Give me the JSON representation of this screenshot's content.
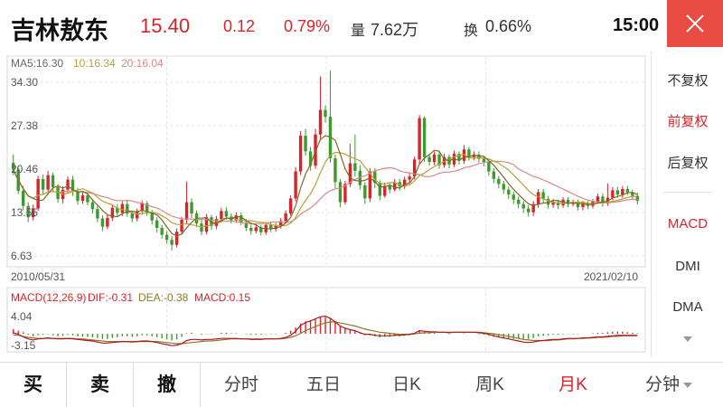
{
  "header": {
    "stock_name": "吉林敖东",
    "price": "15.40",
    "change": "0.12",
    "change_pct": "0.79%",
    "volume_label": "量",
    "volume_value": "7.62万",
    "turnover_label": "换",
    "turnover_value": "0.66%",
    "time": "15:00",
    "close_icon": "close-icon"
  },
  "ma_legend": {
    "ma5": "MA5:16.30",
    "ma10": "10:16.34",
    "ma20": "20:16.04"
  },
  "price_axis": [
    "34.30",
    "27.38",
    "20.46",
    "13.55",
    "6.63"
  ],
  "dates": {
    "start": "2010/05/31",
    "end": "2021/02/10"
  },
  "macd_legend": {
    "params": "MACD(12,26,9)",
    "dif": "DIF:-0.31",
    "dea": "DEA:-0.38",
    "macd": "MACD:0.15"
  },
  "macd_axis": {
    "top": "4.04",
    "bottom": "-3.15"
  },
  "side_panel": {
    "items": [
      "不复权",
      "前复权",
      "后复权"
    ],
    "active": "前复权",
    "indicators": [
      "MACD",
      "DMI",
      "DMA"
    ],
    "active_indicator": "MACD"
  },
  "tabs": {
    "buy": "买",
    "sell": "卖",
    "cancel": "撤",
    "intraday": "分时",
    "five_day": "五日",
    "daily": "日K",
    "weekly": "周K",
    "monthly": "月K",
    "minute": "分钟",
    "active": "月K"
  },
  "colors": {
    "up": "#d9232b",
    "down": "#3e9a2c",
    "ma5": "#7a6a2a",
    "ma10": "#b7a234",
    "ma20": "#d98a8a",
    "accent": "#d9232b"
  },
  "chart_data": {
    "type": "candlestick",
    "ylim": [
      6.63,
      34.3
    ],
    "candles": [
      [
        21.5,
        20.4,
        22.8,
        19.5
      ],
      [
        20.4,
        17.0,
        20.8,
        16.5
      ],
      [
        17.0,
        14.6,
        17.8,
        13.9
      ],
      [
        14.6,
        12.8,
        15.2,
        12.0
      ],
      [
        12.8,
        14.2,
        14.8,
        12.3
      ],
      [
        14.2,
        18.9,
        19.4,
        13.8
      ],
      [
        18.9,
        17.2,
        19.6,
        16.4
      ],
      [
        17.2,
        19.5,
        20.2,
        16.8
      ],
      [
        19.5,
        17.6,
        19.9,
        16.9
      ],
      [
        17.6,
        15.7,
        18.1,
        15.1
      ],
      [
        15.7,
        17.2,
        17.7,
        15.0
      ],
      [
        17.2,
        18.8,
        19.3,
        16.6
      ],
      [
        18.8,
        16.9,
        19.4,
        16.2
      ],
      [
        16.9,
        15.4,
        17.5,
        14.8
      ],
      [
        15.4,
        16.3,
        16.9,
        14.9
      ],
      [
        16.3,
        15.2,
        16.8,
        14.7
      ],
      [
        15.2,
        14.1,
        15.7,
        13.4
      ],
      [
        14.1,
        12.6,
        14.6,
        12.0
      ],
      [
        12.6,
        11.3,
        13.1,
        10.6
      ],
      [
        11.3,
        12.7,
        13.2,
        10.9
      ],
      [
        12.7,
        14.3,
        14.8,
        12.2
      ],
      [
        14.3,
        13.5,
        14.9,
        12.8
      ],
      [
        13.5,
        14.9,
        15.4,
        13.0
      ],
      [
        14.9,
        13.4,
        15.6,
        12.9
      ],
      [
        13.4,
        12.6,
        13.9,
        12.0
      ],
      [
        12.6,
        13.8,
        14.2,
        12.1
      ],
      [
        13.8,
        15.0,
        15.5,
        13.2
      ],
      [
        15.0,
        13.6,
        15.4,
        13.0
      ],
      [
        13.6,
        12.3,
        14.0,
        11.6
      ],
      [
        12.3,
        11.1,
        12.8,
        10.4
      ],
      [
        11.1,
        10.0,
        11.6,
        9.4
      ],
      [
        10.0,
        9.2,
        10.6,
        8.6
      ],
      [
        9.2,
        8.4,
        9.8,
        7.5
      ],
      [
        8.4,
        10.5,
        11.0,
        8.0
      ],
      [
        10.5,
        12.4,
        12.9,
        10.0
      ],
      [
        12.4,
        15.2,
        18.5,
        11.8
      ],
      [
        15.2,
        13.4,
        15.8,
        12.7
      ],
      [
        13.4,
        11.8,
        13.9,
        11.2
      ],
      [
        11.8,
        10.5,
        12.4,
        9.9
      ],
      [
        10.5,
        12.8,
        13.3,
        10.1
      ],
      [
        12.8,
        11.4,
        13.2,
        10.8
      ],
      [
        11.4,
        12.5,
        13.0,
        10.9
      ],
      [
        12.5,
        13.8,
        14.3,
        12.0
      ],
      [
        13.8,
        12.9,
        14.4,
        12.4
      ],
      [
        12.9,
        12.3,
        13.4,
        11.8
      ],
      [
        12.3,
        13.1,
        13.6,
        11.9
      ],
      [
        13.1,
        12.0,
        13.5,
        11.5
      ],
      [
        12.0,
        11.1,
        12.5,
        10.6
      ],
      [
        11.1,
        10.6,
        11.6,
        10.0
      ],
      [
        10.6,
        11.2,
        11.7,
        10.2
      ],
      [
        11.2,
        10.4,
        11.6,
        9.9
      ],
      [
        10.4,
        11.6,
        12.0,
        10.0
      ],
      [
        11.6,
        10.9,
        12.0,
        10.4
      ],
      [
        10.9,
        11.4,
        11.9,
        10.5
      ],
      [
        11.4,
        12.2,
        12.7,
        11.0
      ],
      [
        12.2,
        13.4,
        13.9,
        11.8
      ],
      [
        13.4,
        15.8,
        16.3,
        13.0
      ],
      [
        15.8,
        20.1,
        20.8,
        15.3
      ],
      [
        20.1,
        25.8,
        26.5,
        19.5
      ],
      [
        25.8,
        23.3,
        26.9,
        22.6
      ],
      [
        23.3,
        21.0,
        24.0,
        20.2
      ],
      [
        21.0,
        26.0,
        26.9,
        20.5
      ],
      [
        26.0,
        29.9,
        35.2,
        25.2
      ],
      [
        29.9,
        28.8,
        30.6,
        27.9
      ],
      [
        28.8,
        22.2,
        36.2,
        21.5
      ],
      [
        22.2,
        18.4,
        22.8,
        17.4
      ],
      [
        18.4,
        15.2,
        18.9,
        14.4
      ],
      [
        15.2,
        18.1,
        18.6,
        14.8
      ],
      [
        18.1,
        21.4,
        24.5,
        17.6
      ],
      [
        21.4,
        20.2,
        26.0,
        19.3
      ],
      [
        20.2,
        17.9,
        21.1,
        17.2
      ],
      [
        17.9,
        15.8,
        18.4,
        14.9
      ],
      [
        15.8,
        20.1,
        20.6,
        15.2
      ],
      [
        20.1,
        18.3,
        20.6,
        17.4
      ],
      [
        18.3,
        16.2,
        18.7,
        15.5
      ],
      [
        16.2,
        17.8,
        18.3,
        15.9
      ],
      [
        17.8,
        17.2,
        18.2,
        16.6
      ],
      [
        17.2,
        18.4,
        18.9,
        16.9
      ],
      [
        18.4,
        17.7,
        18.9,
        17.1
      ],
      [
        17.7,
        18.8,
        19.3,
        17.3
      ],
      [
        18.8,
        19.3,
        19.8,
        18.2
      ],
      [
        19.3,
        22.0,
        22.5,
        18.8
      ],
      [
        22.0,
        28.6,
        29.1,
        21.4
      ],
      [
        28.6,
        22.4,
        28.9,
        21.6
      ],
      [
        22.4,
        21.6,
        22.9,
        21.0
      ],
      [
        21.6,
        22.8,
        23.3,
        21.1
      ],
      [
        22.8,
        21.1,
        23.2,
        20.5
      ],
      [
        21.1,
        22.4,
        22.9,
        20.7
      ],
      [
        22.4,
        21.2,
        22.8,
        20.6
      ],
      [
        21.2,
        22.9,
        23.4,
        20.8
      ],
      [
        22.9,
        21.8,
        23.3,
        21.2
      ],
      [
        21.8,
        23.6,
        24.3,
        21.3
      ],
      [
        23.6,
        22.4,
        24.0,
        21.8
      ],
      [
        22.4,
        22.8,
        23.3,
        21.9
      ],
      [
        22.8,
        22.1,
        23.3,
        21.5
      ],
      [
        22.1,
        21.6,
        22.5,
        20.9
      ],
      [
        21.6,
        20.1,
        22.0,
        19.4
      ],
      [
        20.1,
        18.9,
        20.6,
        18.2
      ],
      [
        18.9,
        18.1,
        19.4,
        17.4
      ],
      [
        18.1,
        17.2,
        18.6,
        16.5
      ],
      [
        17.2,
        16.4,
        17.7,
        15.7
      ],
      [
        16.4,
        15.6,
        16.9,
        14.9
      ],
      [
        15.6,
        14.9,
        16.1,
        14.2
      ],
      [
        14.9,
        14.2,
        15.4,
        13.5
      ],
      [
        14.2,
        13.6,
        14.7,
        12.9
      ],
      [
        13.6,
        14.9,
        15.4,
        13.0
      ],
      [
        14.9,
        16.8,
        17.3,
        14.3
      ],
      [
        16.8,
        15.7,
        17.3,
        15.0
      ],
      [
        15.7,
        14.8,
        16.2,
        14.2
      ],
      [
        14.8,
        15.2,
        15.7,
        14.3
      ],
      [
        15.2,
        14.7,
        15.6,
        14.1
      ],
      [
        14.7,
        15.6,
        16.0,
        14.3
      ],
      [
        15.6,
        14.9,
        16.0,
        14.4
      ],
      [
        14.9,
        15.1,
        15.6,
        14.5
      ],
      [
        15.1,
        14.4,
        15.6,
        13.9
      ],
      [
        14.4,
        15.0,
        15.4,
        13.9
      ],
      [
        15.0,
        14.6,
        15.4,
        14.1
      ],
      [
        14.6,
        15.3,
        15.7,
        14.2
      ],
      [
        15.3,
        16.1,
        16.6,
        14.9
      ],
      [
        16.1,
        15.0,
        16.6,
        14.5
      ],
      [
        15.0,
        15.9,
        18.2,
        14.6
      ],
      [
        15.9,
        17.1,
        17.6,
        15.5
      ],
      [
        17.1,
        16.4,
        17.6,
        15.9
      ],
      [
        16.4,
        17.3,
        17.8,
        15.9
      ],
      [
        17.3,
        16.8,
        17.8,
        16.3
      ],
      [
        16.8,
        16.2,
        17.2,
        15.6
      ],
      [
        16.2,
        15.4,
        16.7,
        14.8
      ]
    ],
    "macd": {
      "ylim": [
        -3.15,
        4.04
      ],
      "histogram": [
        0.9,
        0.6,
        0.3,
        -0.2,
        -0.5,
        -0.3,
        -0.2,
        -0.1,
        -0.3,
        -0.5,
        -0.4,
        -0.2,
        -0.3,
        -0.5,
        -0.6,
        -0.6,
        -0.7,
        -0.8,
        -1.0,
        -1.0,
        -0.8,
        -0.7,
        -0.5,
        -0.5,
        -0.6,
        -0.5,
        -0.3,
        -0.3,
        -0.5,
        -0.7,
        -0.9,
        -1.1,
        -1.3,
        -1.1,
        -0.6,
        0.1,
        0.2,
        0.0,
        -0.2,
        -0.1,
        -0.1,
        0.0,
        0.2,
        0.2,
        0.1,
        0.1,
        0.0,
        -0.1,
        -0.2,
        -0.2,
        -0.2,
        -0.1,
        -0.1,
        -0.1,
        0.0,
        0.2,
        0.6,
        1.2,
        2.0,
        2.4,
        2.6,
        2.9,
        3.2,
        3.2,
        2.9,
        2.2,
        1.5,
        1.1,
        0.8,
        0.5,
        0.1,
        -0.3,
        -0.3,
        -0.5,
        -0.7,
        -0.6,
        -0.6,
        -0.5,
        -0.5,
        -0.4,
        -0.3,
        -0.1,
        0.6,
        0.4,
        0.2,
        0.2,
        0.0,
        0.0,
        -0.1,
        0.0,
        0.0,
        0.1,
        0.0,
        0.0,
        -0.1,
        -0.2,
        -0.4,
        -0.6,
        -0.7,
        -0.8,
        -0.9,
        -1.0,
        -1.0,
        -1.0,
        -1.0,
        -0.8,
        -0.5,
        -0.4,
        -0.3,
        -0.2,
        -0.2,
        -0.1,
        -0.1,
        -0.1,
        -0.1,
        0.0,
        0.0,
        0.1,
        0.2,
        0.2,
        0.3,
        0.4,
        0.4,
        0.4,
        0.3,
        0.2,
        0.1
      ],
      "dif": [
        0.2,
        -0.1,
        -0.6,
        -1.0,
        -1.2,
        -1.0,
        -0.9,
        -0.8,
        -0.9,
        -1.0,
        -1.0,
        -0.9,
        -1.0,
        -1.1,
        -1.2,
        -1.3,
        -1.4,
        -1.6,
        -1.8,
        -1.8,
        -1.7,
        -1.6,
        -1.5,
        -1.5,
        -1.6,
        -1.5,
        -1.4,
        -1.4,
        -1.5,
        -1.7,
        -1.9,
        -2.1,
        -2.3,
        -2.2,
        -1.9,
        -1.3,
        -1.1,
        -1.1,
        -1.2,
        -1.1,
        -1.1,
        -1.0,
        -0.9,
        -0.9,
        -0.9,
        -0.9,
        -1.0,
        -1.0,
        -1.1,
        -1.1,
        -1.1,
        -1.0,
        -1.0,
        -1.0,
        -0.9,
        -0.7,
        -0.3,
        0.5,
        1.6,
        2.2,
        2.5,
        2.9,
        3.3,
        3.4,
        3.0,
        2.3,
        1.5,
        1.1,
        0.8,
        0.6,
        0.2,
        -0.1,
        -0.1,
        -0.3,
        -0.4,
        -0.4,
        -0.4,
        -0.3,
        -0.3,
        -0.2,
        -0.1,
        0.1,
        0.6,
        0.5,
        0.4,
        0.4,
        0.3,
        0.3,
        0.2,
        0.3,
        0.3,
        0.3,
        0.3,
        0.3,
        0.2,
        0.1,
        -0.1,
        -0.4,
        -0.6,
        -0.8,
        -1.0,
        -1.2,
        -1.4,
        -1.6,
        -1.7,
        -1.6,
        -1.4,
        -1.3,
        -1.2,
        -1.1,
        -1.1,
        -1.0,
        -0.9,
        -0.9,
        -0.9,
        -0.8,
        -0.8,
        -0.7,
        -0.6,
        -0.6,
        -0.5,
        -0.4,
        -0.3,
        -0.3,
        -0.3,
        -0.3,
        -0.31
      ],
      "dea": [
        -0.2,
        -0.3,
        -0.5,
        -0.7,
        -0.8,
        -0.9,
        -0.9,
        -0.9,
        -0.9,
        -0.9,
        -0.9,
        -0.9,
        -0.9,
        -1.0,
        -1.0,
        -1.1,
        -1.2,
        -1.3,
        -1.4,
        -1.5,
        -1.5,
        -1.5,
        -1.5,
        -1.5,
        -1.5,
        -1.5,
        -1.5,
        -1.5,
        -1.5,
        -1.5,
        -1.6,
        -1.7,
        -1.8,
        -1.9,
        -1.9,
        -1.8,
        -1.7,
        -1.6,
        -1.5,
        -1.4,
        -1.4,
        -1.3,
        -1.2,
        -1.1,
        -1.0,
        -1.0,
        -1.0,
        -1.0,
        -1.0,
        -1.0,
        -1.0,
        -1.0,
        -1.0,
        -1.0,
        -1.0,
        -0.9,
        -0.7,
        -0.4,
        0.1,
        0.6,
        1.0,
        1.4,
        1.8,
        2.1,
        2.3,
        2.3,
        2.1,
        1.9,
        1.7,
        1.5,
        1.2,
        0.9,
        0.7,
        0.5,
        0.3,
        0.2,
        0.1,
        0.0,
        -0.1,
        -0.1,
        -0.1,
        0.0,
        0.1,
        0.2,
        0.2,
        0.3,
        0.3,
        0.3,
        0.3,
        0.3,
        0.3,
        0.3,
        0.3,
        0.3,
        0.3,
        0.2,
        0.1,
        0.0,
        -0.2,
        -0.3,
        -0.5,
        -0.7,
        -0.9,
        -1.1,
        -1.2,
        -1.3,
        -1.3,
        -1.3,
        -1.3,
        -1.2,
        -1.2,
        -1.1,
        -1.0,
        -1.0,
        -0.9,
        -0.9,
        -0.8,
        -0.8,
        -0.7,
        -0.7,
        -0.6,
        -0.5,
        -0.5,
        -0.4,
        -0.4,
        -0.4,
        -0.38
      ]
    }
  }
}
